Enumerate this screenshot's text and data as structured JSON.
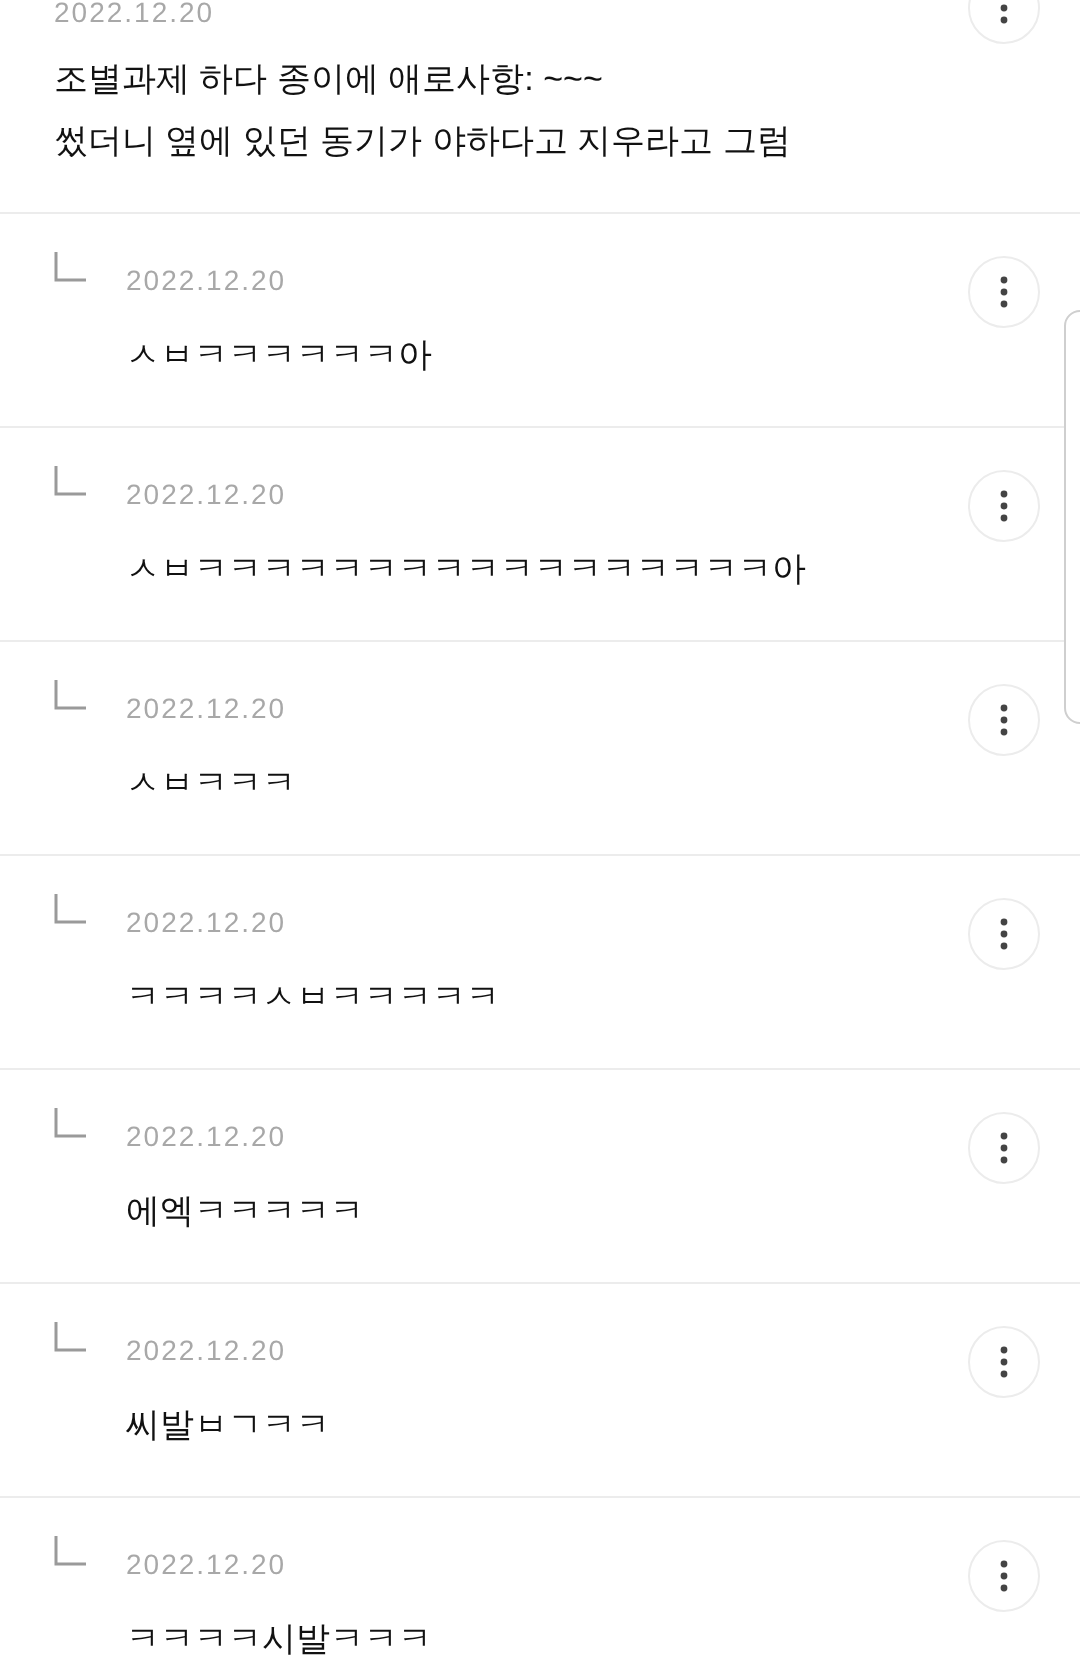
{
  "comments": [
    {
      "kind": "comment",
      "date": "2022.12.20",
      "lines": [
        "조별과제 하다 종이에 애로사항: ~~~",
        "썼더니 옆에 있던 동기가 야하다고 지우라고 그럼"
      ]
    },
    {
      "kind": "reply",
      "date": "2022.12.20",
      "lines": [
        "ㅅㅂㅋㅋㅋㅋㅋㅋ아"
      ]
    },
    {
      "kind": "reply",
      "date": "2022.12.20",
      "lines": [
        "ㅅㅂㅋㅋㅋㅋㅋㅋㅋㅋㅋㅋㅋㅋㅋㅋㅋㅋㅋ아"
      ]
    },
    {
      "kind": "reply",
      "date": "2022.12.20",
      "lines": [
        "ㅅㅂㅋㅋㅋ"
      ]
    },
    {
      "kind": "reply",
      "date": "2022.12.20",
      "lines": [
        "ㅋㅋㅋㅋㅅㅂㅋㅋㅋㅋㅋ"
      ]
    },
    {
      "kind": "reply",
      "date": "2022.12.20",
      "lines": [
        "에엑ㅋㅋㅋㅋㅋ"
      ]
    },
    {
      "kind": "reply",
      "date": "2022.12.20",
      "lines": [
        "씨발ㅂㄱㅋㅋ"
      ]
    },
    {
      "kind": "reply",
      "date": "2022.12.20",
      "lines": [
        "ㅋㅋㅋㅋ시발ㅋㅋㅋ"
      ]
    }
  ]
}
